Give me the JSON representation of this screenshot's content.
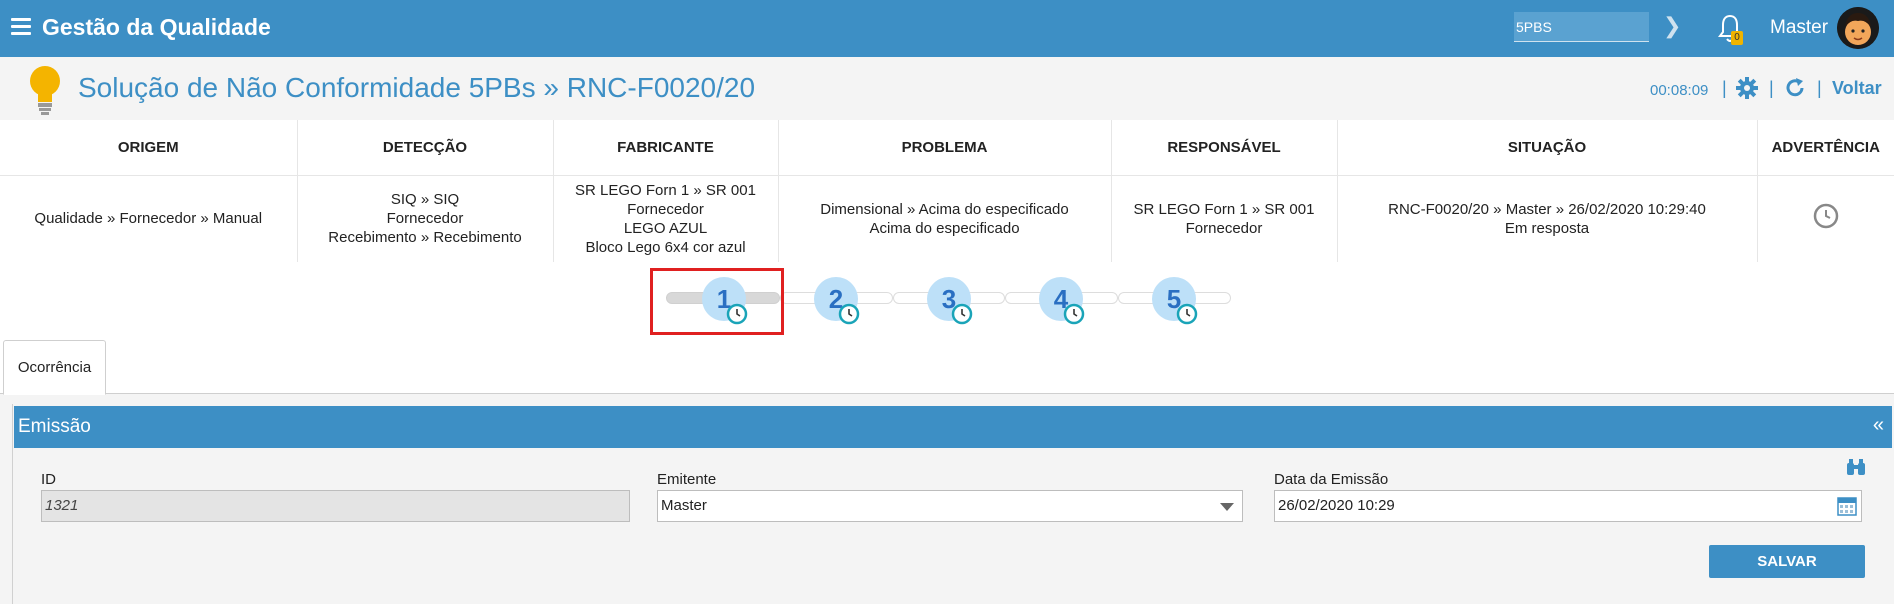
{
  "topbar": {
    "title": "Gestão da Qualidade",
    "search_value": "5PBS",
    "notification_count": "0",
    "user_name": "Master"
  },
  "header": {
    "title": "Solução de Não Conformidade 5PBs » RNC-F0020/20",
    "timer": "00:08:09",
    "back_label": "Voltar"
  },
  "info_table": {
    "columns": [
      "ORIGEM",
      "DETECÇÃO",
      "FABRICANTE",
      "PROBLEMA",
      "RESPONSÁVEL",
      "SITUAÇÃO",
      "ADVERTÊNCIA"
    ],
    "row": {
      "origem": [
        "Qualidade » Fornecedor » Manual"
      ],
      "deteccao": [
        "SIQ » SIQ",
        "Fornecedor",
        "Recebimento » Recebimento"
      ],
      "fabricante": [
        "SR LEGO Forn 1 » SR 001",
        "Fornecedor",
        "LEGO AZUL",
        "Bloco Lego 6x4 cor azul"
      ],
      "problema": [
        "Dimensional » Acima do especificado",
        "Acima do especificado"
      ],
      "responsavel": [
        "SR LEGO Forn 1 » SR 001",
        "Fornecedor"
      ],
      "situacao": [
        "RNC-F0020/20 » Master » 26/02/2020 10:29:40",
        "Em resposta"
      ],
      "advertencia_icon": "clock-icon"
    }
  },
  "steps": [
    {
      "number": "1",
      "active": true
    },
    {
      "number": "2",
      "active": false
    },
    {
      "number": "3",
      "active": false
    },
    {
      "number": "4",
      "active": false
    },
    {
      "number": "5",
      "active": false
    }
  ],
  "tabs": [
    {
      "label": "Ocorrência",
      "active": true
    }
  ],
  "panel": {
    "title": "Emissão",
    "collapse_glyph": "«",
    "fields": {
      "id": {
        "label": "ID",
        "value": "1321"
      },
      "emitente": {
        "label": "Emitente",
        "value": "Master"
      },
      "data_emissao": {
        "label": "Data da Emissão",
        "value": "26/02/2020 10:29"
      }
    },
    "save_label": "SALVAR"
  },
  "colors": {
    "primary": "#3d8fc5",
    "step_circle": "#bde0f8",
    "step_number": "#2a6fc2",
    "highlight": "#e02020"
  }
}
